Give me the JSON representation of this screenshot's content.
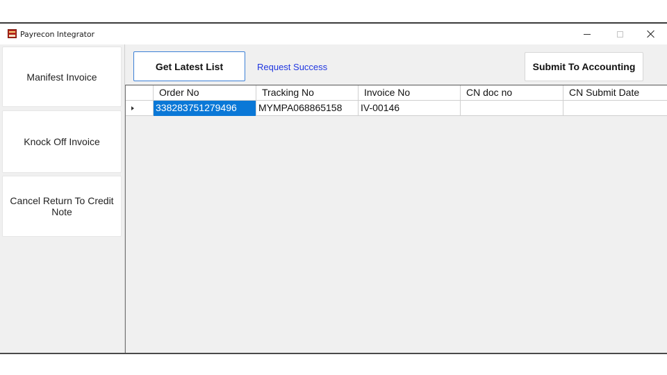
{
  "window": {
    "title": "Payrecon Integrator",
    "icon": "payrecon-logo-icon"
  },
  "sidebar": {
    "items": [
      {
        "label": "Manifest Invoice"
      },
      {
        "label": "Knock Off Invoice"
      },
      {
        "label": "Cancel Return To Credit Note"
      }
    ]
  },
  "toolbar": {
    "get_latest_label": "Get Latest List",
    "status": "Request Success",
    "submit_label": "Submit To Accounting"
  },
  "grid": {
    "columns": [
      "Order No",
      "Tracking No",
      "Invoice No",
      "CN doc no",
      "CN Submit Date"
    ],
    "rows": [
      {
        "current": true,
        "cells": [
          "338283751279496",
          "MYMPA068865158",
          "IV-00146",
          "",
          ""
        ]
      }
    ]
  },
  "colors": {
    "accent": "#3b7fd6",
    "status_text": "#2036e0",
    "selection": "#0a78d7"
  }
}
